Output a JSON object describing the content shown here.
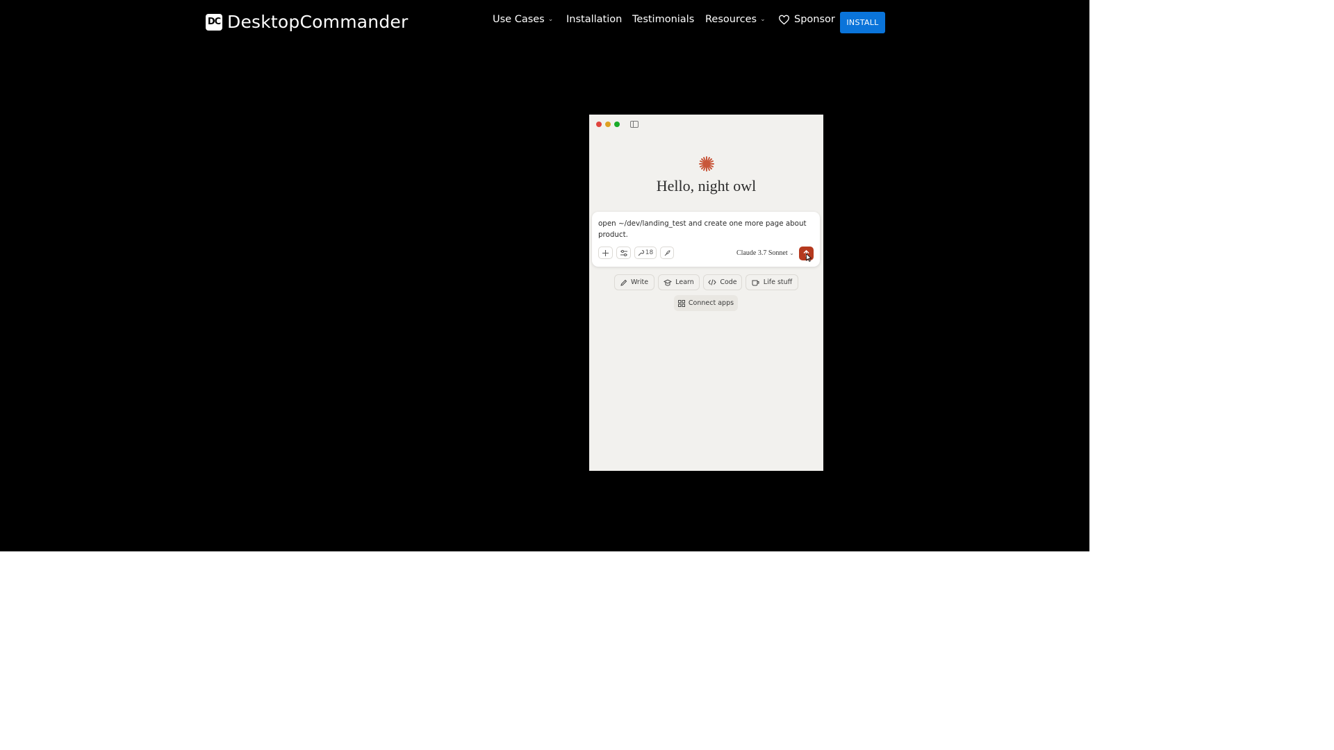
{
  "header": {
    "brand": "DesktopCommander",
    "logo_mark": "DC",
    "nav": [
      {
        "label": "Use Cases",
        "dropdown": true
      },
      {
        "label": "Installation",
        "dropdown": false
      },
      {
        "label": "Testimonials",
        "dropdown": false
      },
      {
        "label": "Resources",
        "dropdown": true
      },
      {
        "label": "Sponsor",
        "icon": "heart-icon"
      }
    ],
    "install_label": "INSTALL",
    "install_color": "#0a74da"
  },
  "demo": {
    "greeting": "Hello, night owl",
    "prompt": "open ~/dev/landing_test and create one more page about product.",
    "tools_count": "18",
    "model": "Claude 3.7 Sonnet",
    "accent": "#b5391e",
    "chips": [
      {
        "label": "Write",
        "icon": "pencil-icon"
      },
      {
        "label": "Learn",
        "icon": "graduation-cap-icon"
      },
      {
        "label": "Code",
        "icon": "code-icon"
      },
      {
        "label": "Life stuff",
        "icon": "coffee-cup-icon"
      },
      {
        "label": "Connect apps",
        "icon": "grid-icon"
      }
    ]
  }
}
